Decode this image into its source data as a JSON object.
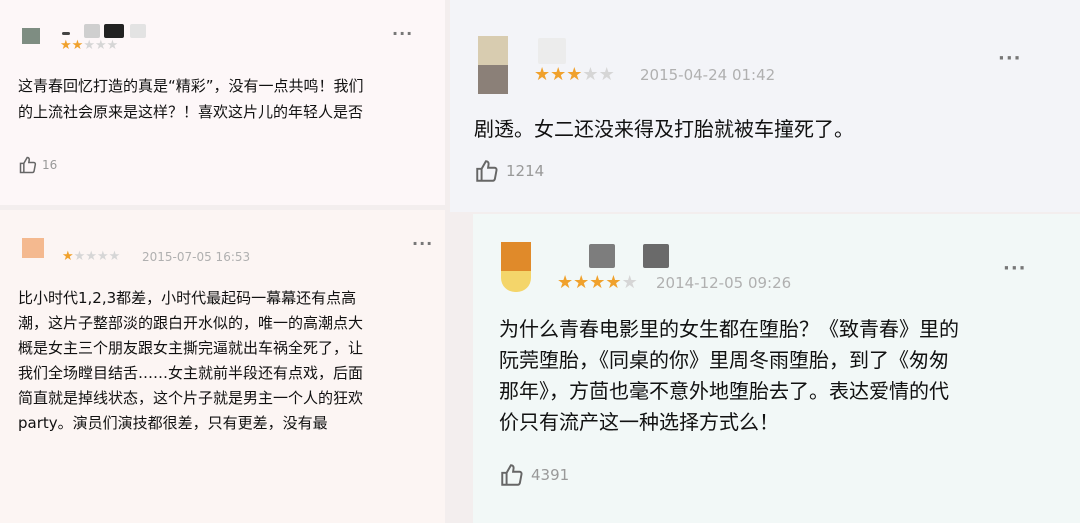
{
  "reviews": [
    {
      "rating": 2,
      "max_rating": 5,
      "date": "",
      "lines": [
        "这青春回忆打造的真是“精彩”，没有一点共鸣！我们",
        "的上流社会原来是这样？！喜欢这片儿的年轻人是否"
      ],
      "likes": "16",
      "avatar_color": "#7e8d82"
    },
    {
      "rating": 3,
      "max_rating": 5,
      "date": "2015-04-24 01:42",
      "lines": [
        "剧透。女二还没来得及打胎就被车撞死了。"
      ],
      "likes": "1214",
      "avatar_color": "#c8b99a"
    },
    {
      "rating": 1,
      "max_rating": 5,
      "date": "2015-07-05 16:53",
      "lines": [
        "比小时代1,2,3都差，小时代最起码一幕幕还有点高",
        "潮，这片子整部淡的跟白开水似的，唯一的高潮点大",
        "概是女主三个朋友跟女主撕完逼就出车祸全死了，让",
        "我们全场瞠目结舌……女主就前半段还有点戏，后面",
        "简直就是掉线状态，这个片子就是男主一个人的狂欢",
        "party。演员们演技都很差，只有更差，没有最"
      ],
      "likes": "",
      "avatar_color": "#f4b98f"
    },
    {
      "rating": 4,
      "max_rating": 5,
      "date": "2014-12-05 09:26",
      "lines": [
        "为什么青春电影里的女生都在堕胎？《致青春》里的",
        "阮莞堕胎，《同桌的你》里周冬雨堕胎，到了《匆匆",
        "那年》，方茴也毫不意外地堕胎去了。表达爱情的代",
        "价只有流产这一种选择方式么！"
      ],
      "likes": "4391",
      "avatar_color": "#e08a2a"
    }
  ],
  "more_label": "···",
  "star_char": "★"
}
